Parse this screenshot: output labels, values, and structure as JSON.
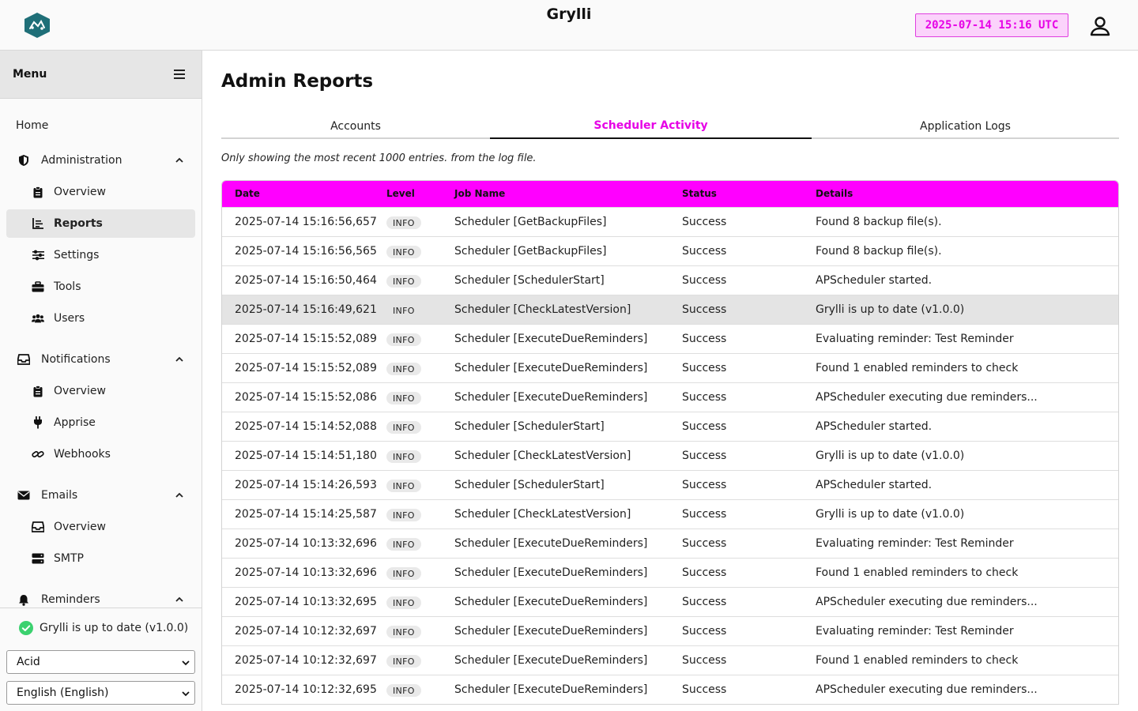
{
  "header": {
    "app_title": "Grylli",
    "clock": "2025-07-14 15:16 UTC"
  },
  "sidebar": {
    "menu_title": "Menu",
    "items": [
      {
        "label": "Home",
        "level": "top",
        "icon": "none"
      },
      {
        "label": "Administration",
        "level": "section",
        "icon": "shield-icon",
        "expanded": true
      },
      {
        "label": "Overview",
        "level": "sub",
        "icon": "clipboard-icon"
      },
      {
        "label": "Reports",
        "level": "sub",
        "icon": "report-icon",
        "active": true
      },
      {
        "label": "Settings",
        "level": "sub",
        "icon": "sliders-icon"
      },
      {
        "label": "Tools",
        "level": "sub",
        "icon": "toolbox-icon"
      },
      {
        "label": "Users",
        "level": "sub",
        "icon": "users-icon"
      },
      {
        "label": "Notifications",
        "level": "section",
        "icon": "inbox-icon",
        "expanded": true
      },
      {
        "label": "Overview",
        "level": "sub",
        "icon": "clipboard-icon"
      },
      {
        "label": "Apprise",
        "level": "sub",
        "icon": "plug-icon"
      },
      {
        "label": "Webhooks",
        "level": "sub",
        "icon": "link-icon"
      },
      {
        "label": "Emails",
        "level": "section",
        "icon": "envelope-icon",
        "expanded": true
      },
      {
        "label": "Overview",
        "level": "sub",
        "icon": "inbox-icon"
      },
      {
        "label": "SMTP",
        "level": "sub",
        "icon": "server-icon"
      },
      {
        "label": "Reminders",
        "level": "section",
        "icon": "bell-icon",
        "expanded": true
      }
    ],
    "update_status": "Grylli is up to date (v1.0.0)",
    "theme_select": "Acid",
    "language_select": "English (English)"
  },
  "main": {
    "page_title": "Admin Reports",
    "tabs": [
      {
        "label": "Accounts",
        "active": false
      },
      {
        "label": "Scheduler Activity",
        "active": true
      },
      {
        "label": "Application Logs",
        "active": false
      }
    ],
    "note": "Only showing the most recent 1000 entries. from the log file.",
    "table": {
      "columns": [
        "Date",
        "Level",
        "Job Name",
        "Status",
        "Details"
      ],
      "rows": [
        {
          "date": "2025-07-14 15:16:56,657",
          "level": "INFO",
          "job": "Scheduler [GetBackupFiles]",
          "status": "Success",
          "details": "Found 8 backup file(s)."
        },
        {
          "date": "2025-07-14 15:16:56,565",
          "level": "INFO",
          "job": "Scheduler [GetBackupFiles]",
          "status": "Success",
          "details": "Found 8 backup file(s)."
        },
        {
          "date": "2025-07-14 15:16:50,464",
          "level": "INFO",
          "job": "Scheduler [SchedulerStart]",
          "status": "Success",
          "details": "APScheduler started."
        },
        {
          "date": "2025-07-14 15:16:49,621",
          "level": "INFO",
          "job": "Scheduler [CheckLatestVersion]",
          "status": "Success",
          "details": "Grylli is up to date (v1.0.0)",
          "hover": true
        },
        {
          "date": "2025-07-14 15:15:52,089",
          "level": "INFO",
          "job": "Scheduler [ExecuteDueReminders]",
          "status": "Success",
          "details": "Evaluating reminder: Test Reminder"
        },
        {
          "date": "2025-07-14 15:15:52,089",
          "level": "INFO",
          "job": "Scheduler [ExecuteDueReminders]",
          "status": "Success",
          "details": "Found 1 enabled reminders to check"
        },
        {
          "date": "2025-07-14 15:15:52,086",
          "level": "INFO",
          "job": "Scheduler [ExecuteDueReminders]",
          "status": "Success",
          "details": "APScheduler executing due reminders..."
        },
        {
          "date": "2025-07-14 15:14:52,088",
          "level": "INFO",
          "job": "Scheduler [SchedulerStart]",
          "status": "Success",
          "details": "APScheduler started."
        },
        {
          "date": "2025-07-14 15:14:51,180",
          "level": "INFO",
          "job": "Scheduler [CheckLatestVersion]",
          "status": "Success",
          "details": "Grylli is up to date (v1.0.0)"
        },
        {
          "date": "2025-07-14 15:14:26,593",
          "level": "INFO",
          "job": "Scheduler [SchedulerStart]",
          "status": "Success",
          "details": "APScheduler started."
        },
        {
          "date": "2025-07-14 15:14:25,587",
          "level": "INFO",
          "job": "Scheduler [CheckLatestVersion]",
          "status": "Success",
          "details": "Grylli is up to date (v1.0.0)"
        },
        {
          "date": "2025-07-14 10:13:32,696",
          "level": "INFO",
          "job": "Scheduler [ExecuteDueReminders]",
          "status": "Success",
          "details": "Evaluating reminder: Test Reminder"
        },
        {
          "date": "2025-07-14 10:13:32,696",
          "level": "INFO",
          "job": "Scheduler [ExecuteDueReminders]",
          "status": "Success",
          "details": "Found 1 enabled reminders to check"
        },
        {
          "date": "2025-07-14 10:13:32,695",
          "level": "INFO",
          "job": "Scheduler [ExecuteDueReminders]",
          "status": "Success",
          "details": "APScheduler executing due reminders..."
        },
        {
          "date": "2025-07-14 10:12:32,697",
          "level": "INFO",
          "job": "Scheduler [ExecuteDueReminders]",
          "status": "Success",
          "details": "Evaluating reminder: Test Reminder"
        },
        {
          "date": "2025-07-14 10:12:32,697",
          "level": "INFO",
          "job": "Scheduler [ExecuteDueReminders]",
          "status": "Success",
          "details": "Found 1 enabled reminders to check"
        },
        {
          "date": "2025-07-14 10:12:32,695",
          "level": "INFO",
          "job": "Scheduler [ExecuteDueReminders]",
          "status": "Success",
          "details": "APScheduler executing due reminders..."
        }
      ]
    }
  },
  "colors": {
    "accent": "#ff00ff",
    "accent_text": "#e600e6",
    "clock_bg": "#fbd3fb",
    "logo": "#1f6f78",
    "success": "#3bd16f"
  }
}
